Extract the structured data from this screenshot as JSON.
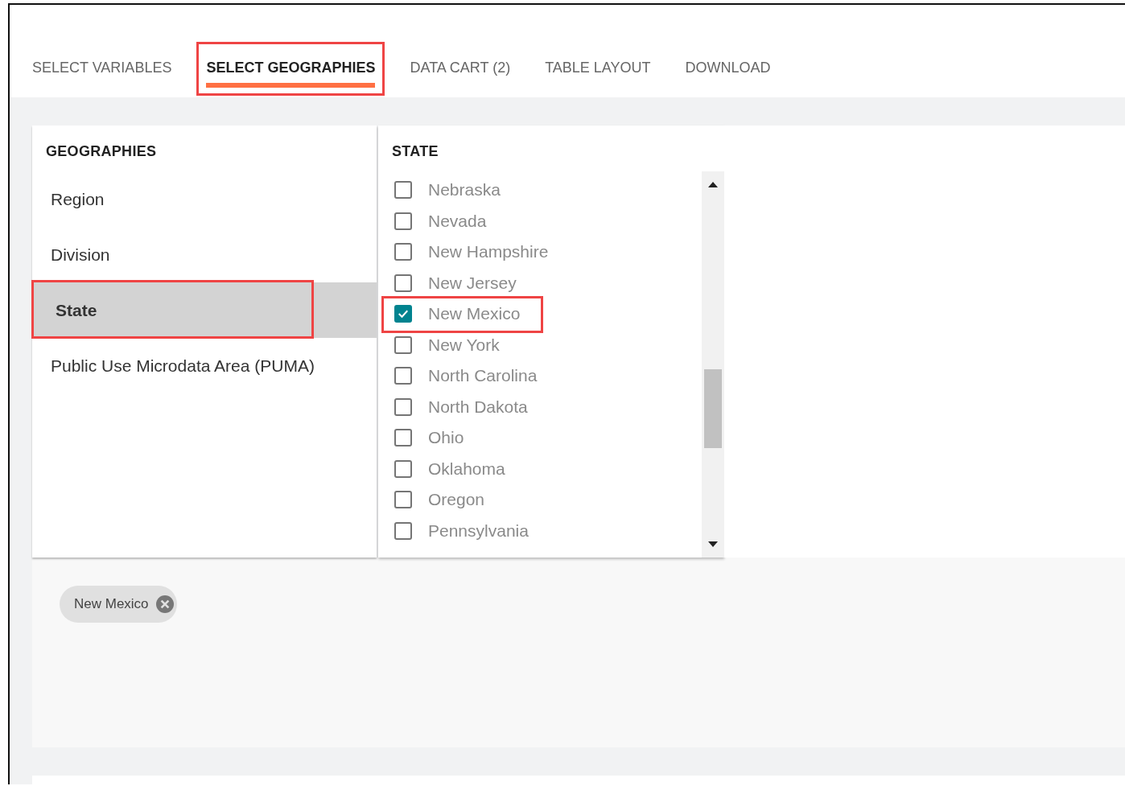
{
  "tabs": [
    {
      "label": "SELECT VARIABLES",
      "selected": false,
      "highlighted": false
    },
    {
      "label": "SELECT GEOGRAPHIES",
      "selected": true,
      "highlighted": true
    },
    {
      "label": "DATA CART (2)",
      "selected": false,
      "highlighted": false
    },
    {
      "label": "TABLE LAYOUT",
      "selected": false,
      "highlighted": false
    },
    {
      "label": "DOWNLOAD",
      "selected": false,
      "highlighted": false
    }
  ],
  "geographies": {
    "heading": "GEOGRAPHIES",
    "items": [
      {
        "label": "Region",
        "selected": false,
        "highlighted": false
      },
      {
        "label": "Division",
        "selected": false,
        "highlighted": false
      },
      {
        "label": "State",
        "selected": true,
        "highlighted": true
      },
      {
        "label": "Public Use Microdata Area (PUMA)",
        "selected": false,
        "highlighted": false
      }
    ]
  },
  "state": {
    "heading": "STATE",
    "items": [
      {
        "label": "Nebraska",
        "checked": false,
        "highlighted": false
      },
      {
        "label": "Nevada",
        "checked": false,
        "highlighted": false
      },
      {
        "label": "New Hampshire",
        "checked": false,
        "highlighted": false
      },
      {
        "label": "New Jersey",
        "checked": false,
        "highlighted": false
      },
      {
        "label": "New Mexico",
        "checked": true,
        "highlighted": true
      },
      {
        "label": "New York",
        "checked": false,
        "highlighted": false
      },
      {
        "label": "North Carolina",
        "checked": false,
        "highlighted": false
      },
      {
        "label": "North Dakota",
        "checked": false,
        "highlighted": false
      },
      {
        "label": "Ohio",
        "checked": false,
        "highlighted": false
      },
      {
        "label": "Oklahoma",
        "checked": false,
        "highlighted": false
      },
      {
        "label": "Oregon",
        "checked": false,
        "highlighted": false
      },
      {
        "label": "Pennsylvania",
        "checked": false,
        "highlighted": false
      }
    ]
  },
  "selection_chips": [
    {
      "label": "New Mexico"
    }
  ]
}
